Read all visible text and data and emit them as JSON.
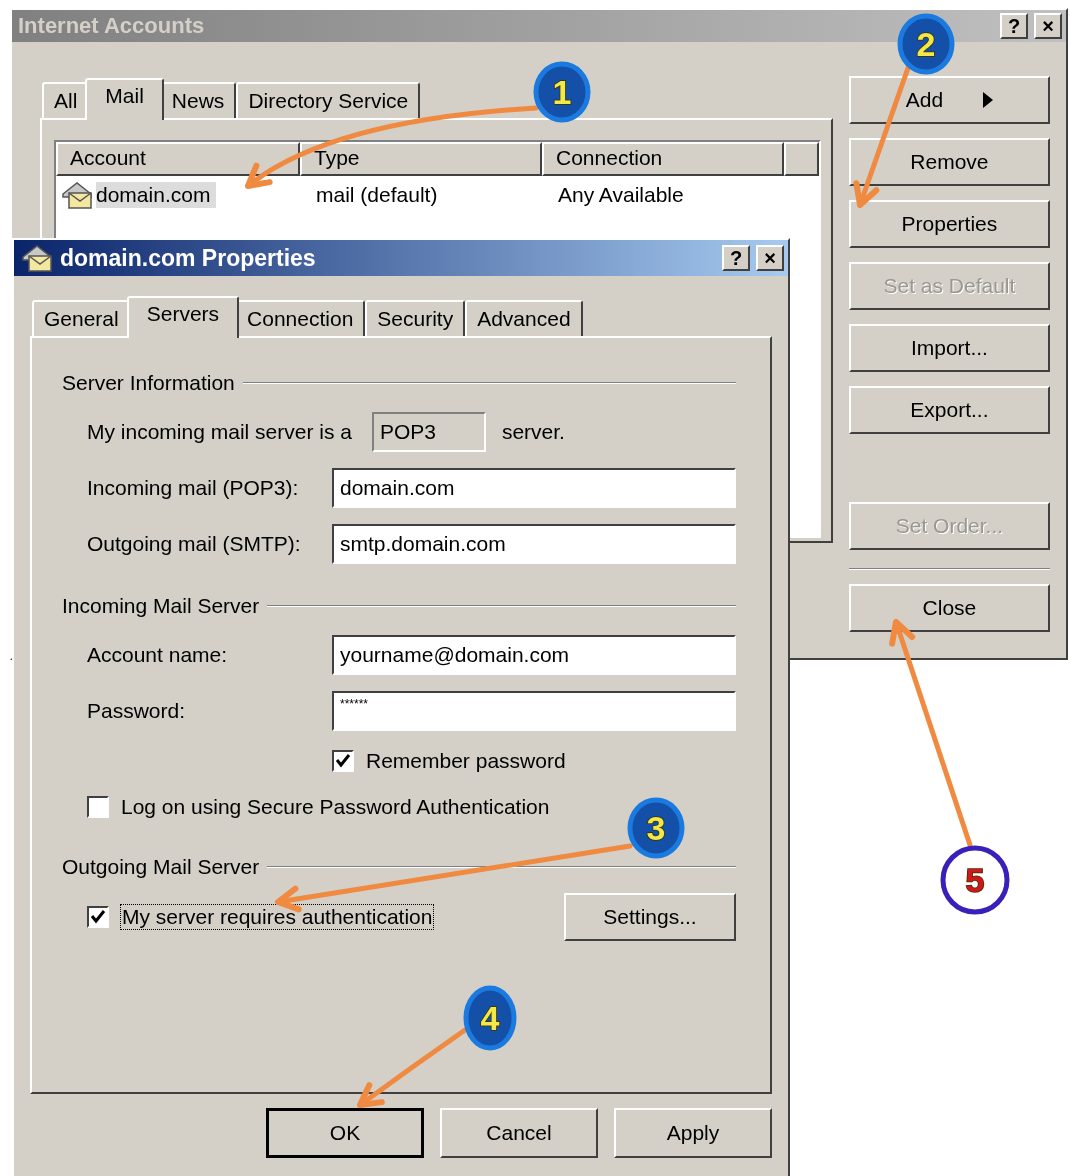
{
  "accounts_window": {
    "title": "Internet Accounts",
    "help_button": "?",
    "close_button": "×",
    "tabs": [
      {
        "label": "All",
        "selected": false
      },
      {
        "label": "Mail",
        "selected": true
      },
      {
        "label": "News",
        "selected": false
      },
      {
        "label": "Directory Service",
        "selected": false
      }
    ],
    "columns": [
      "Account",
      "Type",
      "Connection"
    ],
    "rows": [
      {
        "account": "domain.com",
        "type": "mail (default)",
        "connection": "Any Available",
        "selected": true
      }
    ],
    "buttons": [
      {
        "label": "Add",
        "kind": "menu",
        "disabled": false
      },
      {
        "label": "Remove",
        "kind": "plain",
        "disabled": false
      },
      {
        "label": "Properties",
        "kind": "plain",
        "disabled": false
      },
      {
        "label": "Set as Default",
        "kind": "plain",
        "disabled": true
      },
      {
        "label": "Import...",
        "kind": "plain",
        "disabled": false
      },
      {
        "label": "Export...",
        "kind": "plain",
        "disabled": false
      }
    ],
    "set_order_button": {
      "label": "Set Order...",
      "disabled": true
    },
    "close": {
      "label": "Close"
    }
  },
  "properties_dialog": {
    "title": "domain.com Properties",
    "help_button": "?",
    "close_button": "×",
    "tabs": [
      {
        "label": "General",
        "selected": false
      },
      {
        "label": "Servers",
        "selected": true
      },
      {
        "label": "Connection",
        "selected": false
      },
      {
        "label": "Security",
        "selected": false
      },
      {
        "label": "Advanced",
        "selected": false
      }
    ],
    "server_information": {
      "title": "Server Information",
      "server_type_label": "My incoming mail server is a",
      "server_type": "POP3",
      "server_type_suffix": "server.",
      "fields": [
        {
          "label": "Incoming mail (POP3):",
          "value": "domain.com"
        },
        {
          "label": "Outgoing mail (SMTP):",
          "value": "smtp.domain.com"
        }
      ]
    },
    "incoming_mail_server": {
      "title": "Incoming Mail Server",
      "fields": [
        {
          "label": "Account name:",
          "value": "yourname@domain.com"
        },
        {
          "label": "Password:",
          "value": "******"
        }
      ],
      "remember_password": {
        "label": "Remember password",
        "checked": true
      },
      "secure_password_auth": {
        "label": "Log on using Secure Password Authentication",
        "checked": false
      }
    },
    "outgoing_mail_server": {
      "title": "Outgoing Mail Server",
      "requires_auth": {
        "label": "My server requires authentication",
        "checked": true,
        "focused": true
      },
      "settings_button": "Settings..."
    },
    "buttons": [
      {
        "label": "OK",
        "default": true
      },
      {
        "label": "Cancel",
        "default": false
      },
      {
        "label": "Apply",
        "default": false
      }
    ]
  },
  "annotations": [
    {
      "label": "1",
      "kind": "step"
    },
    {
      "label": "2",
      "kind": "step"
    },
    {
      "label": "3",
      "kind": "step"
    },
    {
      "label": "4",
      "kind": "step"
    },
    {
      "label": "5",
      "kind": "final"
    }
  ]
}
